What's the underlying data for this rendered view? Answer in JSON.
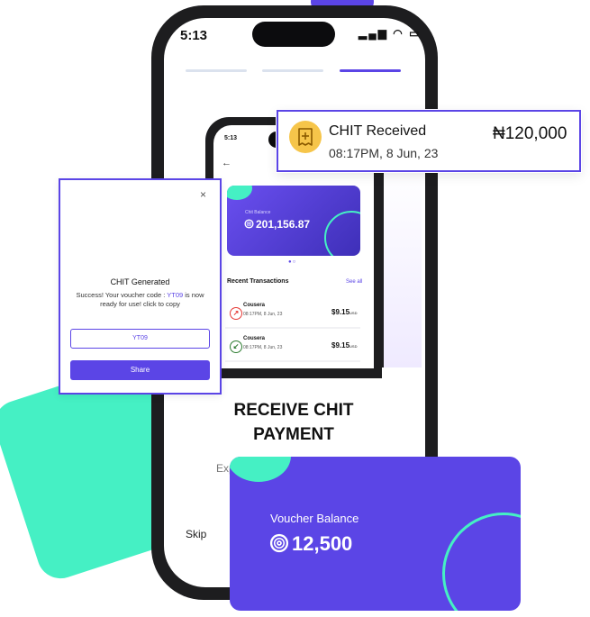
{
  "status_bar": {
    "time": "5:13",
    "icons": "▂▄▆ ◠ ▭"
  },
  "onboarding": {
    "title": "RECEIVE CHIT PAYMENT",
    "subtitle_fragment": "Exp",
    "skip_label": "Skip",
    "progress_steps": 3,
    "active_step": 3
  },
  "mini_app": {
    "time": "5:13",
    "back_icon": "←",
    "card_label": "Chit Balance",
    "balance": "201,156.87",
    "recent_title": "Recent Transactions",
    "see_all": "See all",
    "transactions": [
      {
        "name": "Cousera",
        "date": "08:17PM, 8 Jun, 23",
        "amount": "$9.15",
        "currency": "USD",
        "direction": "out"
      },
      {
        "name": "Cousera",
        "date": "08:17PM, 8 Jun, 23",
        "amount": "$9.15",
        "currency": "USD",
        "direction": "in"
      }
    ]
  },
  "notification": {
    "title": "CHIT Received",
    "time": "08:17PM, 8 Jun, 23",
    "amount": "₦120,000"
  },
  "dialog": {
    "close": "×",
    "title": "CHIT  Generated",
    "message_prefix": "Success! Your voucher code : ",
    "code": "YT09",
    "message_suffix": " is now ready for use! click to copy",
    "code_box": "YT09",
    "share_label": "Share"
  },
  "voucher": {
    "label": "Voucher Balance",
    "amount": "12,500"
  },
  "colors": {
    "brand_purple": "#5b45e6",
    "accent_teal": "#45f0c4",
    "badge_yellow": "#f6c54a"
  }
}
